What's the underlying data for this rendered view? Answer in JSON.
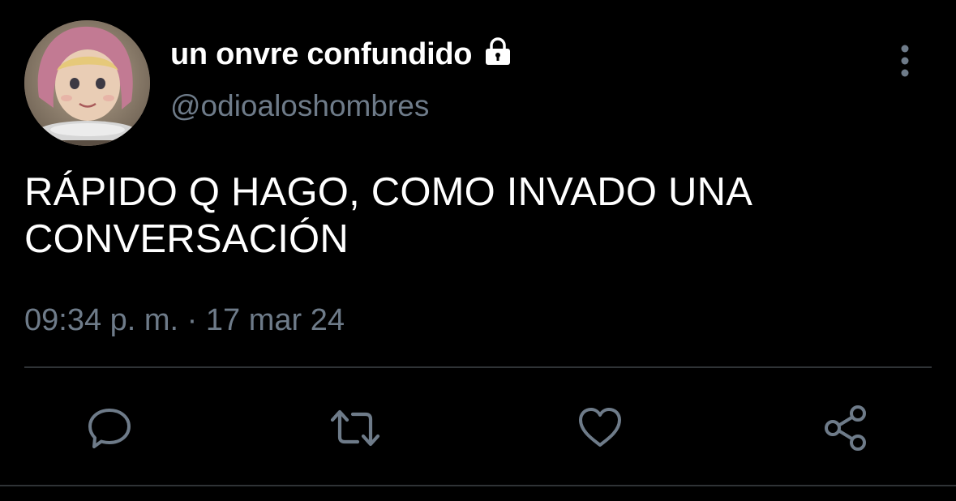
{
  "tweet": {
    "author": {
      "display_name": "un onvre confundido",
      "handle": "@odioaloshombres",
      "protected_icon": "lock-icon"
    },
    "text_lines": [
      "RÁPIDO Q HAGO, COMO INVADO UNA",
      "CONVERSACIÓN"
    ],
    "timestamp": "09:34 p. m. · 17 mar 24",
    "more_icon": "vertical-dots-icon",
    "actions": [
      {
        "name": "reply",
        "icon": "chat-bubble-icon"
      },
      {
        "name": "retweet",
        "icon": "retweet-arrows-icon"
      },
      {
        "name": "like",
        "icon": "heart-icon"
      },
      {
        "name": "share",
        "icon": "share-nodes-icon"
      }
    ]
  },
  "colors": {
    "background": "#000000",
    "text_primary": "#ffffff",
    "text_secondary": "#6e7b89",
    "icon": "#6e7b89",
    "divider": "#2f3336"
  }
}
